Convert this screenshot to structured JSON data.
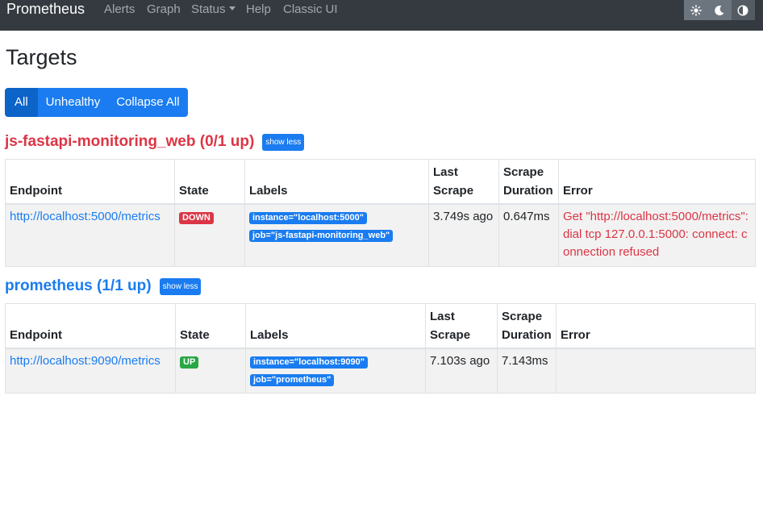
{
  "navbar": {
    "brand": "Prometheus",
    "links": {
      "alerts": "Alerts",
      "graph": "Graph",
      "status": "Status",
      "help": "Help",
      "classic": "Classic UI"
    },
    "theme_icons": [
      "sun-icon",
      "moon-icon",
      "contrast-icon"
    ]
  },
  "page": {
    "title": "Targets"
  },
  "filters": {
    "all": "All",
    "unhealthy": "Unhealthy",
    "collapse_all": "Collapse All"
  },
  "table_headers": {
    "endpoint": "Endpoint",
    "state": "State",
    "labels": "Labels",
    "last": "Last",
    "scrape": "Scrape",
    "duration": "Duration",
    "error": "Error"
  },
  "pools": [
    {
      "title": "js-fastapi-monitoring_web (0/1 up)",
      "show_less": "show less",
      "title_color": "#dc3545",
      "targets": [
        {
          "endpoint": "http://localhost:5000/metrics",
          "state": "DOWN",
          "labels": [
            "instance=\"localhost:5000\"",
            "job=\"js-fastapi-monitoring_web\""
          ],
          "last_scrape": "3.749s ago",
          "scrape_duration": "0.647ms",
          "error": "Get \"http://localhost:5000/metrics\": dial tcp 127.0.0.1:5000: connect: connection refused"
        }
      ]
    },
    {
      "title": "prometheus (1/1 up)",
      "show_less": "show less",
      "title_color": "#1a7cf0",
      "targets": [
        {
          "endpoint": "http://localhost:9090/metrics",
          "state": "UP",
          "labels": [
            "instance=\"localhost:9090\"",
            "job=\"prometheus\""
          ],
          "last_scrape": "7.103s ago",
          "scrape_duration": "7.143ms",
          "error": ""
        }
      ]
    }
  ],
  "colors": {
    "navbar_bg": "#343a40",
    "primary": "#1a7cf0",
    "danger": "#dc3545",
    "success": "#28a745"
  }
}
